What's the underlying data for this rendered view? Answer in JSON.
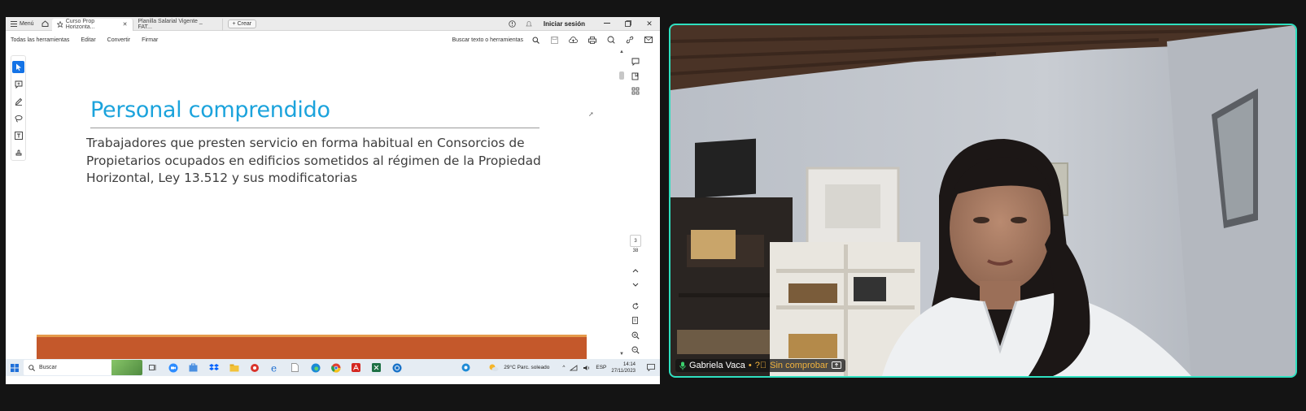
{
  "browser": {
    "menu_label": "Menú",
    "tabs": [
      {
        "label": "Curso Prop Horizonta..."
      },
      {
        "label": "Planilla Salarial Vigente _ FAT..."
      }
    ],
    "new_tab_label": "Crear",
    "signin_label": "Iniciar sesión"
  },
  "toolbar": {
    "all_tools": "Todas las herramientas",
    "edit": "Editar",
    "convert": "Convertir",
    "sign": "Firmar",
    "search_label": "Buscar texto o herramientas"
  },
  "slide": {
    "title": "Personal comprendido",
    "body": "Trabajadores que presten servicio en forma habitual en Consorcios de Propietarios ocupados en edificios sometidos al régimen de la Propiedad Horizontal, Ley 13.512 y sus modificatorias"
  },
  "pager": {
    "current": "3",
    "total": "38"
  },
  "taskbar": {
    "search_label": "Buscar",
    "weather": "29°C  Parc. soleado",
    "lang": "ESP",
    "time": "14:14",
    "date": "27/11/2023"
  },
  "participant": {
    "name": "Gabriela Vaca",
    "status": "Sin comprobar"
  },
  "colors": {
    "title_blue": "#1ba3dc",
    "band_orange": "#c4582b",
    "speaker_border": "#2ee0c0"
  }
}
